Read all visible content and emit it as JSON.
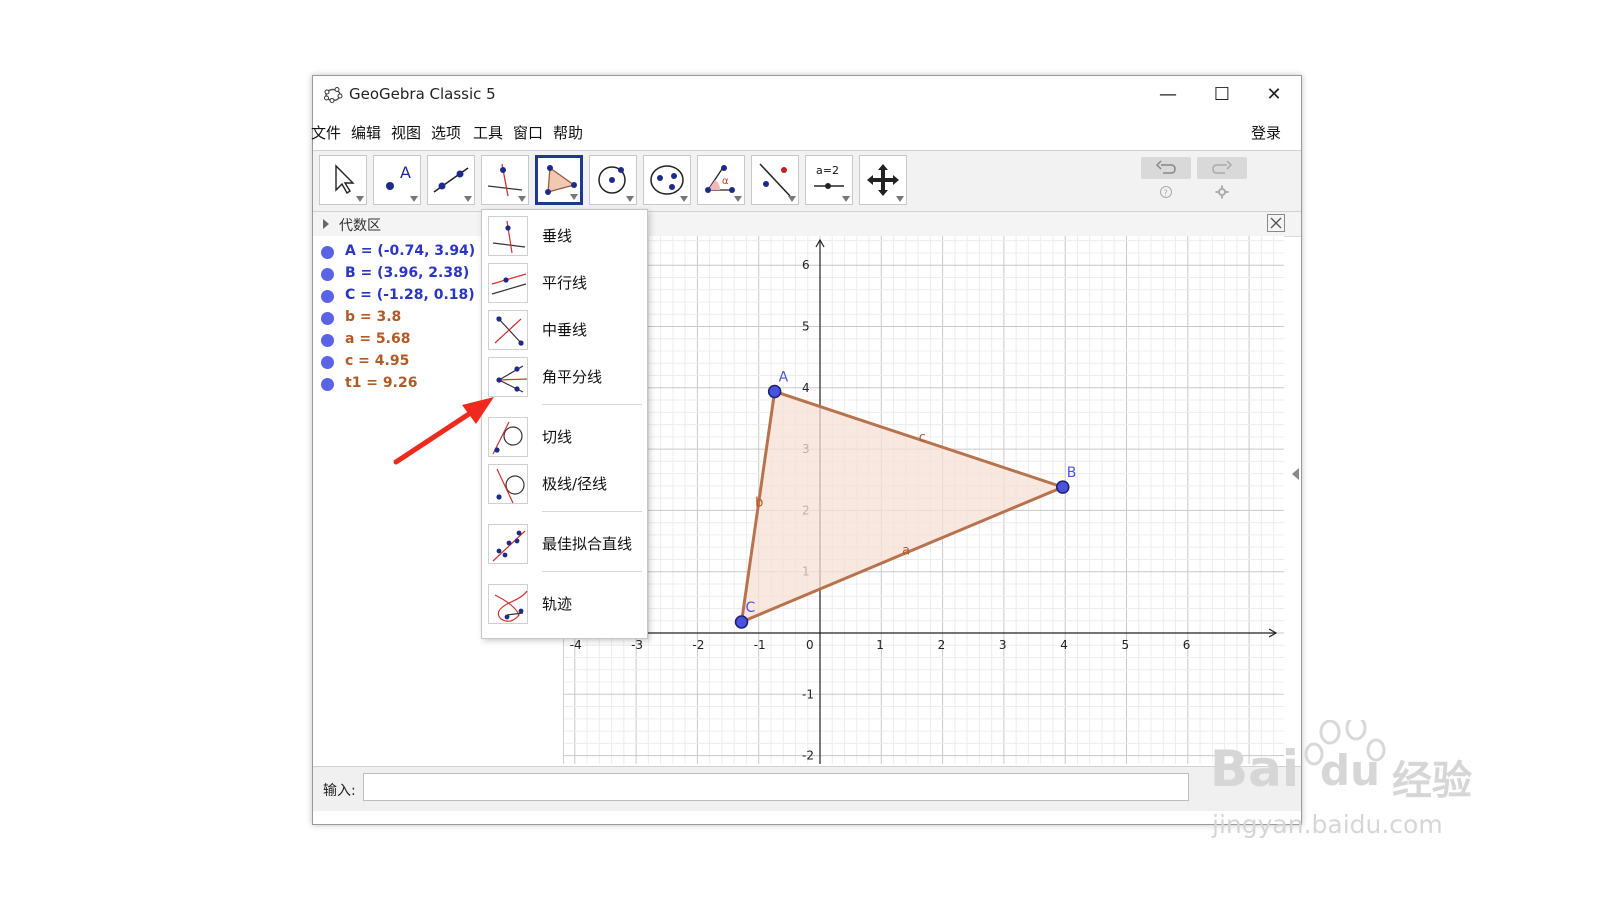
{
  "window": {
    "title": "GeoGebra Classic 5",
    "minimize": "—",
    "maximize": "☐",
    "close": "✕"
  },
  "menu": {
    "items": [
      "文件",
      "编辑",
      "视图",
      "选项",
      "工具",
      "窗口",
      "帮助"
    ],
    "login": "登录"
  },
  "algebra": {
    "title": "代数区",
    "items": [
      {
        "text": "A = (-0.74, 3.94)",
        "color": "#2b35c4"
      },
      {
        "text": "B = (3.96, 2.38)",
        "color": "#2b35c4"
      },
      {
        "text": "C = (-1.28, 0.18)",
        "color": "#2b35c4"
      },
      {
        "text": "b = 3.8",
        "color": "#b05a28"
      },
      {
        "text": "a = 5.68",
        "color": "#b05a28"
      },
      {
        "text": "c = 4.95",
        "color": "#b05a28"
      },
      {
        "text": "t1 = 9.26",
        "color": "#b05a28"
      }
    ]
  },
  "toolbar": {
    "slider_label": "a=2"
  },
  "dropdown": {
    "items": [
      {
        "label": "垂线",
        "icon": "perpendicular-line-icon"
      },
      {
        "label": "平行线",
        "icon": "parallel-line-icon"
      },
      {
        "label": "中垂线",
        "icon": "perpendicular-bisector-icon"
      },
      {
        "label": "角平分线",
        "icon": "angle-bisector-icon"
      },
      {
        "label": "切线",
        "icon": "tangent-icon"
      },
      {
        "label": "极线/径线",
        "icon": "polar-line-icon"
      },
      {
        "label": "最佳拟合直线",
        "icon": "best-fit-line-icon"
      },
      {
        "label": "轨迹",
        "icon": "locus-icon"
      }
    ]
  },
  "graph": {
    "x_ticks": [
      "-4",
      "-3",
      "-2",
      "-1",
      "0",
      "1",
      "2",
      "3",
      "4",
      "5",
      "6"
    ],
    "y_ticks": [
      "-2",
      "-1",
      "1",
      "2",
      "3",
      "4",
      "5",
      "6"
    ],
    "points": [
      {
        "name": "A",
        "x": -0.74,
        "y": 3.94
      },
      {
        "name": "B",
        "x": 3.96,
        "y": 2.38
      },
      {
        "name": "C",
        "x": -1.28,
        "y": 0.18
      }
    ],
    "segments": [
      "a",
      "b",
      "c"
    ],
    "colors": {
      "point": "#4b52e0",
      "polygon_fill": "#f5e0d6",
      "polygon_edge": "#b8734e"
    }
  },
  "input": {
    "label": "输入:"
  },
  "watermark": {
    "brand": "Bai",
    "brand2": "du",
    "brand_cn": "经验",
    "url": "jingyan.baidu.com"
  }
}
